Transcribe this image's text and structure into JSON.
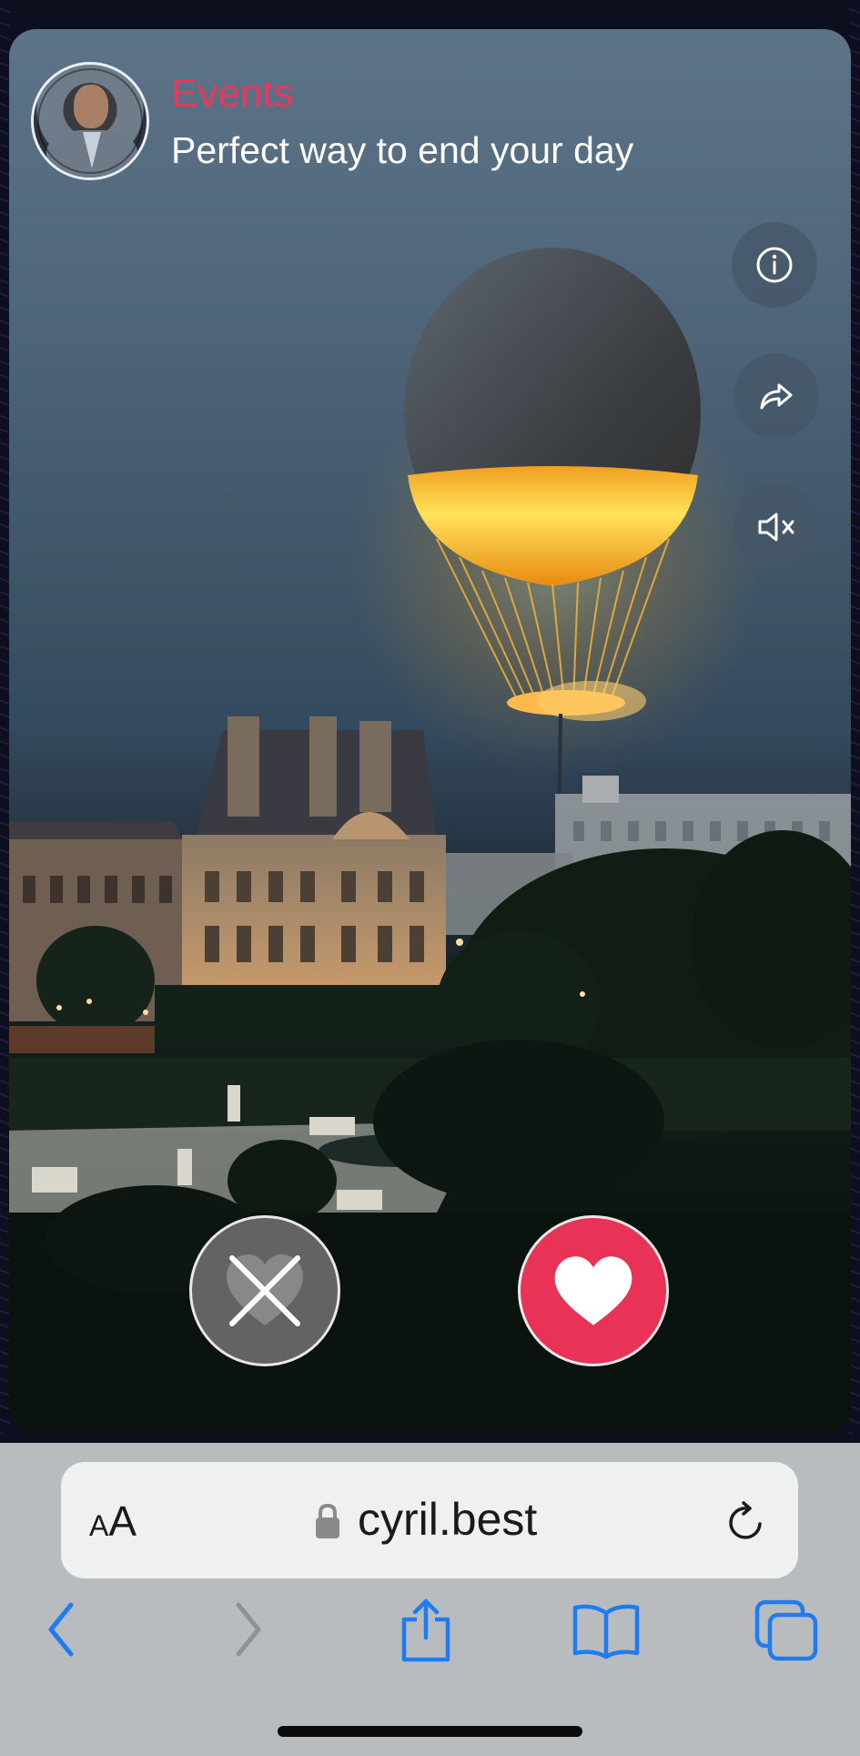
{
  "feed": {
    "category": "Events",
    "subtitle": "Perfect way to end your day",
    "avatar": "profile-photo-man-in-suit"
  },
  "side_actions": [
    "info-icon",
    "share-icon",
    "mute-icon"
  ],
  "actions": {
    "dislike_icon": "x-over-heart-icon",
    "like_icon": "heart-icon"
  },
  "browser": {
    "text_size_label_small": "A",
    "text_size_label_large": "A",
    "url": "cyril.best",
    "toolbar": [
      "back-icon",
      "forward-icon",
      "share-icon",
      "bookmarks-icon",
      "tabs-icon"
    ]
  },
  "colors": {
    "accent": "#e8385e",
    "like_button": "#e83357",
    "dislike_button": "#636363",
    "ios_blue": "#1e7cf2"
  }
}
